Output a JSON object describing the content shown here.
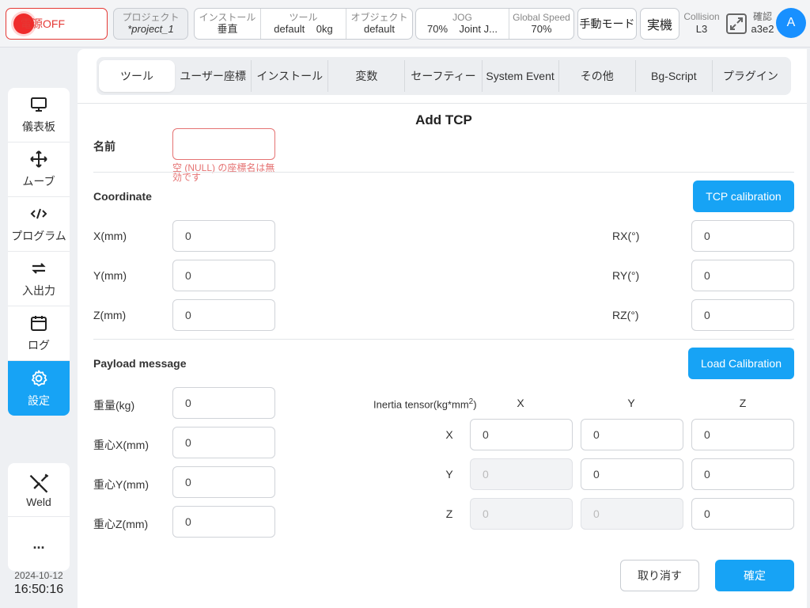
{
  "topbar": {
    "power_label": "電源OFF",
    "project_label": "プロジェクト",
    "project_value": "*project_1",
    "install_label": "インストール",
    "install_value": "垂直",
    "tool_label": "ツール",
    "tool_value": "default",
    "tool_weight": "0kg",
    "object_label": "オブジェクト",
    "object_value": "default",
    "jog_label": "JOG",
    "jog_percent": "70%",
    "jog_mode": "Joint J...",
    "speed_label": "Global Speed",
    "speed_value": "70%",
    "manual_mode": "手動モード",
    "real_machine": "実機",
    "collision_label": "Collision",
    "collision_value": "L3",
    "confirm_label": "確認",
    "confirm_value": "a3e2",
    "avatar": "A"
  },
  "sidebar": {
    "items": [
      {
        "label": "儀表板",
        "icon": "monitor-icon"
      },
      {
        "label": "ムーブ",
        "icon": "move-icon"
      },
      {
        "label": "プログラム",
        "icon": "code-icon"
      },
      {
        "label": "入出力",
        "icon": "io-icon"
      },
      {
        "label": "ログ",
        "icon": "calendar-icon"
      },
      {
        "label": "設定",
        "icon": "gear-icon"
      }
    ],
    "weld_label": "Weld",
    "more_label": "...",
    "date": "2024-10-12",
    "time": "16:50:16",
    "active_color": "#17a3f5"
  },
  "tabs": [
    "ツール",
    "ユーザー座標",
    "インストール",
    "変数",
    "セーフティー",
    "System Event",
    "その他",
    "Bg-Script",
    "プラグイン"
  ],
  "form": {
    "title": "Add TCP",
    "name_label": "名前",
    "name_value": "",
    "name_error": "空 (NULL) の座標名は無効です",
    "coordinate_label": "Coordinate",
    "tcp_calibration": "TCP calibration",
    "x_label": "X(mm)",
    "x_value": "0",
    "y_label": "Y(mm)",
    "y_value": "0",
    "z_label": "Z(mm)",
    "z_value": "0",
    "rx_label": "RX(°)",
    "rx_value": "0",
    "ry_label": "RY(°)",
    "ry_value": "0",
    "rz_label": "RZ(°)",
    "rz_value": "0",
    "payload_label": "Payload message",
    "load_calibration": "Load Calibration",
    "weight_label": "重量(kg)",
    "weight_value": "0",
    "cx_label": "重心X(mm)",
    "cx_value": "0",
    "cy_label": "重心Y(mm)",
    "cy_value": "0",
    "cz_label": "重心Z(mm)",
    "cz_value": "0",
    "inertia_label": "Inertia tensor(kg*mm",
    "inertia_sup": "2",
    "inertia_close": ")",
    "col_x": "X",
    "col_y": "Y",
    "col_z": "Z",
    "row_x": "X",
    "row_y": "Y",
    "row_z": "Z",
    "ixx": "0",
    "ixy": "0",
    "ixz": "0",
    "iyx": "0",
    "iyy": "0",
    "iyz": "0",
    "izx": "0",
    "izy": "0",
    "izz": "0",
    "cancel": "取り消す",
    "ok": "確定"
  }
}
